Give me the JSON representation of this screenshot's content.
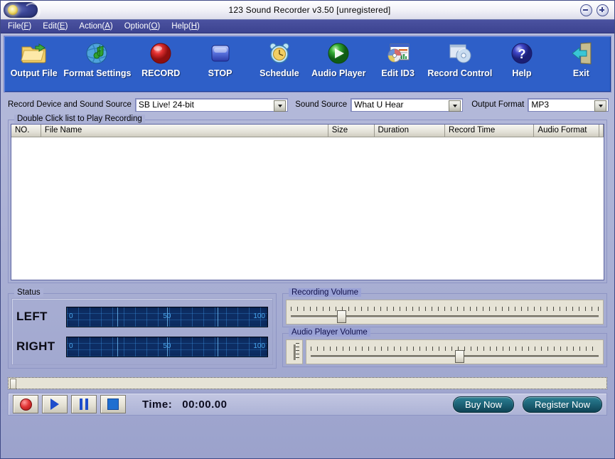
{
  "window": {
    "title": "123 Sound Recorder v3.50  [unregistered]",
    "icon": "app-orb-icon",
    "minimize_label": "minimize-icon",
    "close_label": "close-icon"
  },
  "menu": {
    "items": [
      {
        "text": "File(F)",
        "before": "File(",
        "accel": "F",
        "after": ")"
      },
      {
        "text": "Edit(E)",
        "before": "Edit(",
        "accel": "E",
        "after": ")"
      },
      {
        "text": "Action(A)",
        "before": "Action(",
        "accel": "A",
        "after": ")"
      },
      {
        "text": "Option(O)",
        "before": "Option(",
        "accel": "O",
        "after": ")"
      },
      {
        "text": "Help(H)",
        "before": "Help(",
        "accel": "H",
        "after": ")"
      }
    ]
  },
  "toolbar": {
    "buttons": [
      {
        "label": "Output File",
        "icon": "folder-icon"
      },
      {
        "label": "Format Settings",
        "icon": "globe-note-icon"
      },
      {
        "label": "RECORD",
        "icon": "red-record-icon"
      },
      {
        "label": "STOP",
        "icon": "blue-stop-icon"
      },
      {
        "label": "Schedule",
        "icon": "alarm-clock-icon"
      },
      {
        "label": "Audio Player",
        "icon": "green-play-icon"
      },
      {
        "label": "Edit ID3",
        "icon": "cd-tag-icon"
      },
      {
        "label": "Record Control",
        "icon": "disc-window-icon"
      },
      {
        "label": "Help",
        "icon": "question-icon"
      },
      {
        "label": "Exit",
        "icon": "exit-door-icon"
      }
    ]
  },
  "settings": {
    "device_label": "Record Device and Sound Source",
    "device_value": "SB Live! 24-bit",
    "source_label": "Sound Source",
    "source_value": "What U Hear",
    "format_label": "Output Format",
    "format_value": "MP3"
  },
  "list": {
    "caption": "Double Click list to Play Recording",
    "columns": [
      "NO.",
      "File Name",
      "Size",
      "Duration",
      "Record Time",
      "Audio Format"
    ],
    "rows": []
  },
  "status": {
    "caption": "Status",
    "left_label": "LEFT",
    "right_label": "RIGHT",
    "scale": [
      "0",
      "50",
      "100"
    ],
    "left_level": 0,
    "right_level": 0
  },
  "recording_volume": {
    "caption": "Recording Volume",
    "value_percent": 15
  },
  "player_volume": {
    "caption": "Audio Player Volume",
    "value_percent": 50,
    "balance_percent": 50
  },
  "transport": {
    "seek_percent": 0,
    "record_button": "record-button",
    "play_button": "play-button",
    "pause_button": "pause-button",
    "stop_button": "stop-button",
    "time_label": "Time:",
    "time_value": "00:00.00",
    "buy_label": "Buy Now",
    "register_label": "Register Now"
  },
  "colors": {
    "toolbar_blue": "#2e5fc8",
    "titlebar_menu": "#3c4390",
    "meter_bg": "#0d2d63",
    "meter_ink": "#49a8ef",
    "pill_teal": "#1c6276",
    "window_face": "#aab0d6"
  }
}
